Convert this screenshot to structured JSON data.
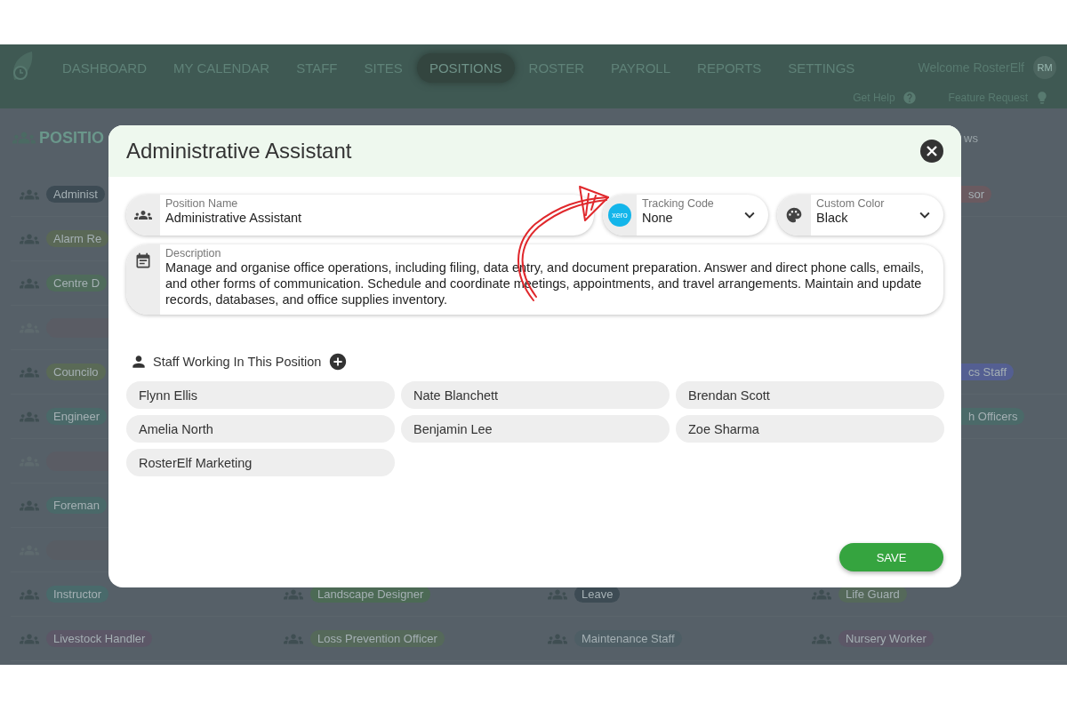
{
  "nav": {
    "items": [
      {
        "label": "DASHBOARD",
        "selected": false
      },
      {
        "label": "MY CALENDAR",
        "selected": false
      },
      {
        "label": "STAFF",
        "selected": false
      },
      {
        "label": "SITES",
        "selected": false
      },
      {
        "label": "POSITIONS",
        "selected": true
      },
      {
        "label": "ROSTER",
        "selected": false
      },
      {
        "label": "PAYROLL",
        "selected": false
      },
      {
        "label": "REPORTS",
        "selected": false
      },
      {
        "label": "SETTINGS",
        "selected": false
      }
    ],
    "welcome": "Welcome RosterElf",
    "avatar": "RM",
    "help": "Get Help",
    "feature_request": "Feature Request"
  },
  "page": {
    "title": "POSITIO",
    "corner_text": "ws",
    "rows": [
      {
        "cells": [
          {
            "kind": "chip",
            "label": "Administ",
            "color": "#3d4b54"
          },
          {
            "kind": "partial",
            "label": "sor",
            "color": "#6a5a60"
          }
        ]
      },
      {
        "cells": [
          {
            "kind": "chip",
            "label": "Alarm Re",
            "color": "#5a6856"
          }
        ]
      },
      {
        "cells": [
          {
            "kind": "chip",
            "label": "Centre D",
            "color": "#4f6b5b"
          }
        ]
      },
      {
        "cells": [
          {
            "kind": "faded",
            "color": "#5d5a62"
          }
        ]
      },
      {
        "cells": [
          {
            "kind": "chip",
            "label": "Councilo",
            "color": "#5a6a56"
          },
          {
            "kind": "partial",
            "label": "cs Staff",
            "color": "#545f92"
          }
        ]
      },
      {
        "cells": [
          {
            "kind": "chip",
            "label": "Engineer",
            "color": "#4a6969"
          },
          {
            "kind": "partial",
            "label": "h Officers",
            "color": "#4b6a69"
          }
        ]
      },
      {
        "cells": [
          {
            "kind": "faded",
            "color": "#5d5a62"
          }
        ]
      },
      {
        "cells": [
          {
            "kind": "chip",
            "label": "Foreman",
            "color": "#4a6969"
          }
        ]
      },
      {
        "cells": [
          {
            "kind": "faded",
            "color": "#5a5c63"
          }
        ]
      },
      {
        "cells": [
          {
            "kind": "chip",
            "label": "Instructor",
            "color": "#496a6b"
          },
          {
            "kind": "chip",
            "label": "Landscape Designer",
            "color": "#4c6a55"
          },
          {
            "kind": "chip",
            "label": "Leave",
            "color": "#3d4b54"
          },
          {
            "kind": "chip",
            "label": "Life Guard",
            "color": "#55695a"
          }
        ]
      },
      {
        "cells": [
          {
            "kind": "chip",
            "label": "Livestock Handler",
            "color": "#5c5767"
          },
          {
            "kind": "chip",
            "label": "Loss Prevention Officer",
            "color": "#55695a"
          },
          {
            "kind": "chip",
            "label": "Maintenance Staff",
            "color": "#4e5e65"
          },
          {
            "kind": "chip",
            "label": "Nursery Worker",
            "color": "#5c5767"
          }
        ]
      }
    ]
  },
  "dialog": {
    "title": "Administrative Assistant",
    "position_name": {
      "label": "Position Name",
      "value": "Administrative Assistant"
    },
    "tracking_code": {
      "label": "Tracking Code",
      "value": "None",
      "logo_text": "xero"
    },
    "custom_color": {
      "label": "Custom Color",
      "value": "Black"
    },
    "description": {
      "label": "Description",
      "value": "Manage and organise office operations, including filing, data entry, and document preparation. Answer and direct phone calls, emails, and other forms of communication. Schedule and coordinate meetings, appointments, and travel arrangements. Maintain and update records, databases, and office supplies inventory."
    },
    "staff": {
      "heading": "Staff Working In This Position",
      "members": [
        "Flynn Ellis",
        "Nate Blanchett",
        "Brendan Scott",
        "Amelia North",
        "Benjamin Lee",
        "Zoe Sharma",
        "RosterElf Marketing"
      ]
    },
    "save": "SAVE"
  }
}
